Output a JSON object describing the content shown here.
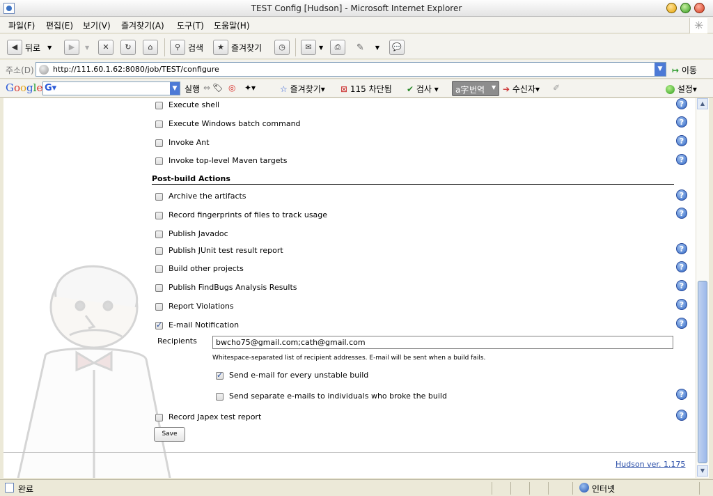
{
  "window": {
    "title": "TEST Config [Hudson] - Microsoft Internet Explorer"
  },
  "menubar": {
    "items": [
      "파일(F)",
      "편집(E)",
      "보기(V)",
      "즐겨찾기(A)",
      "도구(T)",
      "도움말(H)"
    ]
  },
  "toolbar": {
    "back_label": "뒤로",
    "search_label": "검색",
    "favorites_label": "즐겨찾기"
  },
  "address": {
    "label": "주소(D)",
    "url": "http://111.60.1.62:8080/job/TEST/configure",
    "go_label": "이동"
  },
  "google_toolbar": {
    "logo": [
      "G",
      "o",
      "o",
      "g",
      "l",
      "e"
    ],
    "search_value": "",
    "run_label": "실행",
    "favorites_label": "즐겨찾기",
    "blocked_label": "115 차단됨",
    "check_label": "검사",
    "translate_label": "번역",
    "send_label": "수신자",
    "settings_label": "설정"
  },
  "build_steps": [
    {
      "label": "Execute shell",
      "checked": false
    },
    {
      "label": "Execute Windows batch command",
      "checked": false
    },
    {
      "label": "Invoke Ant",
      "checked": false
    },
    {
      "label": "Invoke top-level Maven targets",
      "checked": false
    }
  ],
  "post_build": {
    "header": "Post-build Actions",
    "actions": [
      {
        "label": "Archive the artifacts",
        "checked": false
      },
      {
        "label": "Record fingerprints of files to track usage",
        "checked": false
      },
      {
        "label": "Publish Javadoc",
        "checked": false
      },
      {
        "label": "Publish JUnit test result report",
        "checked": false
      },
      {
        "label": "Build other projects",
        "checked": false
      },
      {
        "label": "Publish FindBugs Analysis Results",
        "checked": false
      },
      {
        "label": "Report Violations",
        "checked": false
      },
      {
        "label": "E-mail Notification",
        "checked": true
      }
    ],
    "email": {
      "recipients_label": "Recipients",
      "recipients_value": "bwcho75@gmail.com;cath@gmail.com",
      "recipients_help": "Whitespace-separated list of recipient addresses. E-mail will be sent when a build fails.",
      "unstable_label": "Send e-mail for every unstable build",
      "unstable_checked": true,
      "separate_label": "Send separate e-mails to individuals who broke the build",
      "separate_checked": false
    },
    "japex": {
      "label": "Record Japex test report",
      "checked": false
    }
  },
  "save_label": "Save",
  "footer": {
    "version_link": "Hudson ver. 1.175"
  },
  "statusbar": {
    "status_text": "완료",
    "zone_text": "인터넷"
  },
  "colors": {
    "link": "#2a4ea8",
    "help_icon": "#2f66c4",
    "status_ok": "#2c9a1a"
  }
}
